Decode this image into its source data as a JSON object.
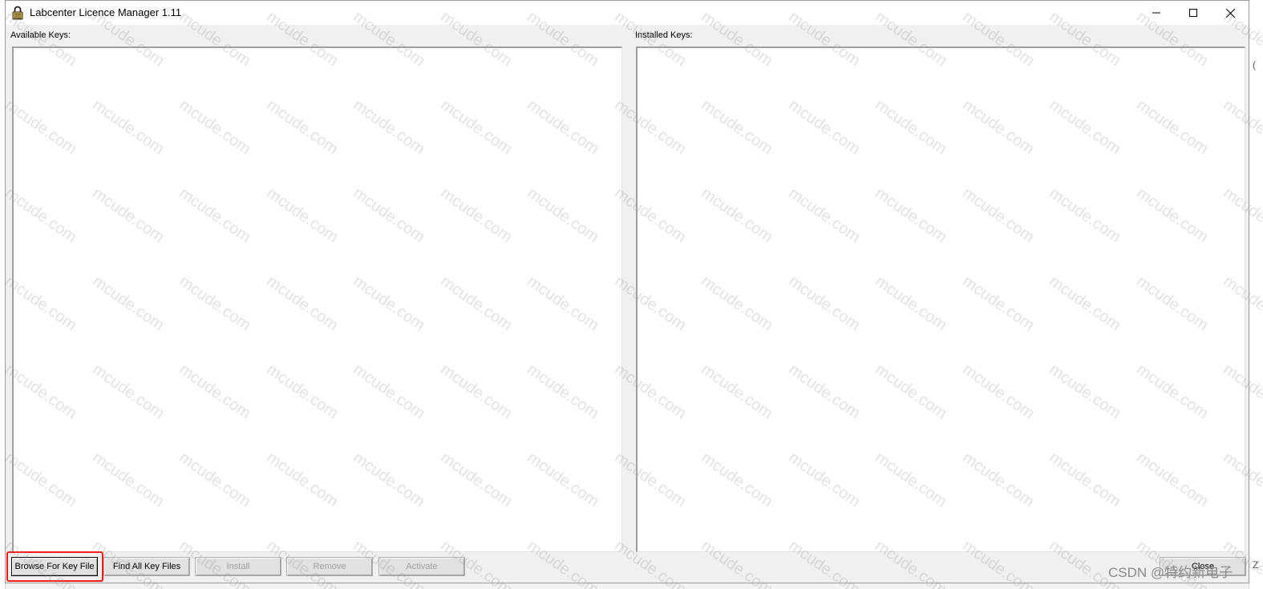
{
  "window": {
    "title": "Labcenter Licence Manager 1.11",
    "minimize_glyph": "─",
    "maximize_glyph": "☐",
    "close_glyph": "✕"
  },
  "panels": {
    "available_label": "Available Keys:",
    "installed_label": "Installed Keys:"
  },
  "buttons": {
    "browse": "Browse For Key File",
    "find_all": "Find All Key Files",
    "install": "Install",
    "remove": "Remove",
    "activate": "Activate",
    "close": "Close"
  },
  "background": {
    "right_glyph_top": "(",
    "right_glyph_bottom": "Z"
  },
  "watermarks": {
    "site": "mcude.com",
    "csdn": "CSDN @特约新电子"
  },
  "colors": {
    "highlight": "#ff1a1a"
  },
  "icons": {
    "app": "padlock-icon"
  }
}
